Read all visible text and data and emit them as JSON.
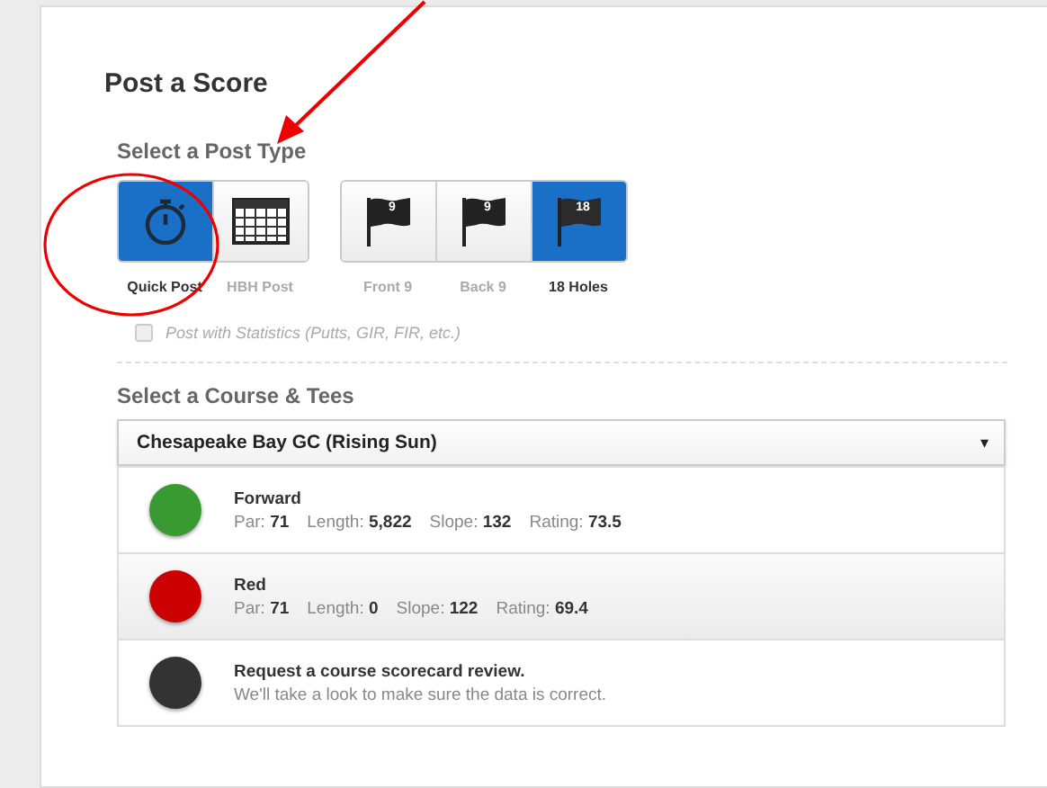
{
  "title": "Post a Score",
  "post_type": {
    "heading": "Select a Post Type",
    "annotation": {
      "kind": "arrow"
    },
    "groups": [
      {
        "annotation": {
          "kind": "circle"
        },
        "items": [
          {
            "kind": "stopwatch",
            "label": "Quick Post",
            "selected": true
          },
          {
            "kind": "grid",
            "label": "HBH Post",
            "selected": false
          }
        ]
      },
      {
        "items": [
          {
            "kind": "flag",
            "flag_number": "9",
            "label": "Front 9",
            "selected": false
          },
          {
            "kind": "flag",
            "flag_number": "9",
            "label": "Back 9",
            "selected": false
          },
          {
            "kind": "flag",
            "flag_number": "18",
            "label": "18 Holes",
            "selected": true
          }
        ]
      }
    ]
  },
  "statistics_option": {
    "label": "Post with Statistics (Putts, GIR, FIR, etc.)",
    "checked": false,
    "disabled": true
  },
  "course": {
    "heading": "Select a Course & Tees",
    "value": "Chesapeake Bay GC (Rising Sun)",
    "caret": "▾",
    "tees": [
      {
        "kind": "tee",
        "name": "Forward",
        "color": "#3a9a32",
        "selected": false,
        "stats": [
          {
            "label": "Par:",
            "value": "71"
          },
          {
            "label": "Length:",
            "value": "5,822"
          },
          {
            "label": "Slope:",
            "value": "132"
          },
          {
            "label": "Rating:",
            "value": "73.5"
          }
        ]
      },
      {
        "kind": "tee",
        "name": "Red",
        "color": "#cc0000",
        "selected": true,
        "stats": [
          {
            "label": "Par:",
            "value": "71"
          },
          {
            "label": "Length:",
            "value": "0"
          },
          {
            "label": "Slope:",
            "value": "122"
          },
          {
            "label": "Rating:",
            "value": "69.4"
          }
        ]
      },
      {
        "kind": "request",
        "name": "Request a course scorecard review.",
        "color": "#333333",
        "selected": false,
        "description": "We'll take a look to make sure the data is correct."
      }
    ]
  }
}
